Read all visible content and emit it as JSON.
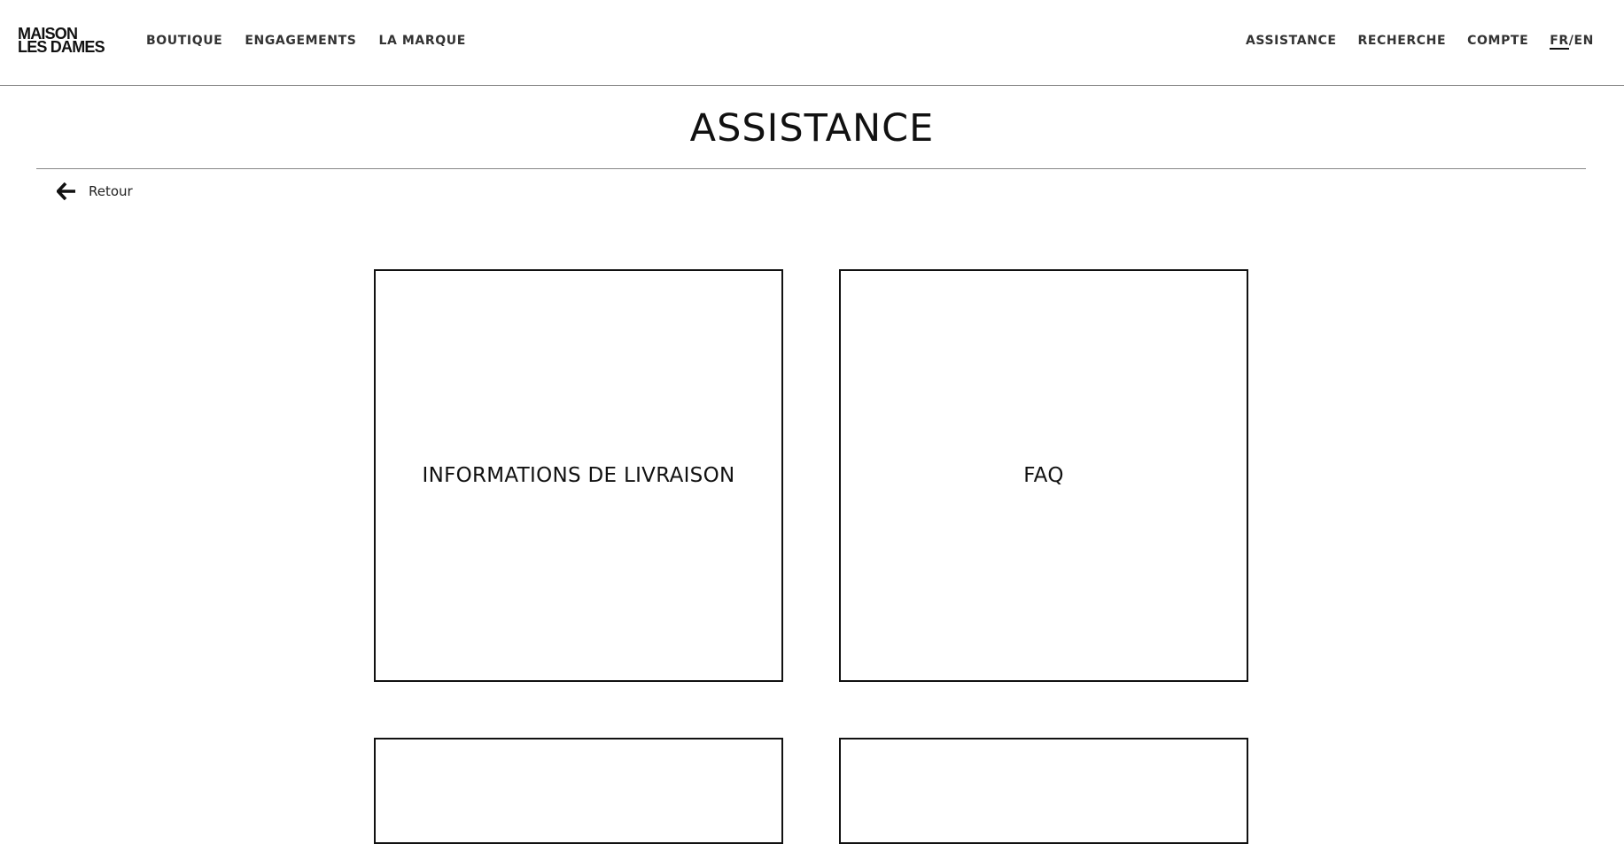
{
  "brand": {
    "line1": "MAISON",
    "line2": "LES DAMES"
  },
  "nav_left": [
    {
      "label": "BOUTIQUE"
    },
    {
      "label": "ENGAGEMENTS"
    },
    {
      "label": "LA MARQUE"
    }
  ],
  "nav_right": [
    {
      "label": "ASSISTANCE"
    },
    {
      "label": "RECHERCHE"
    },
    {
      "label": "COMPTE"
    }
  ],
  "language": {
    "fr": "FR",
    "separator": "/",
    "en": "EN",
    "active": "FR"
  },
  "page": {
    "title": "ASSISTANCE",
    "back_label": "Retour",
    "back_icon": "arrow-left-icon"
  },
  "cards": [
    {
      "label": "INFORMATIONS DE LIVRAISON"
    },
    {
      "label": "FAQ"
    },
    {
      "label": ""
    },
    {
      "label": ""
    }
  ],
  "colors": {
    "text": "#111111",
    "border": "#111111",
    "rule": "#888888",
    "background": "#ffffff"
  }
}
